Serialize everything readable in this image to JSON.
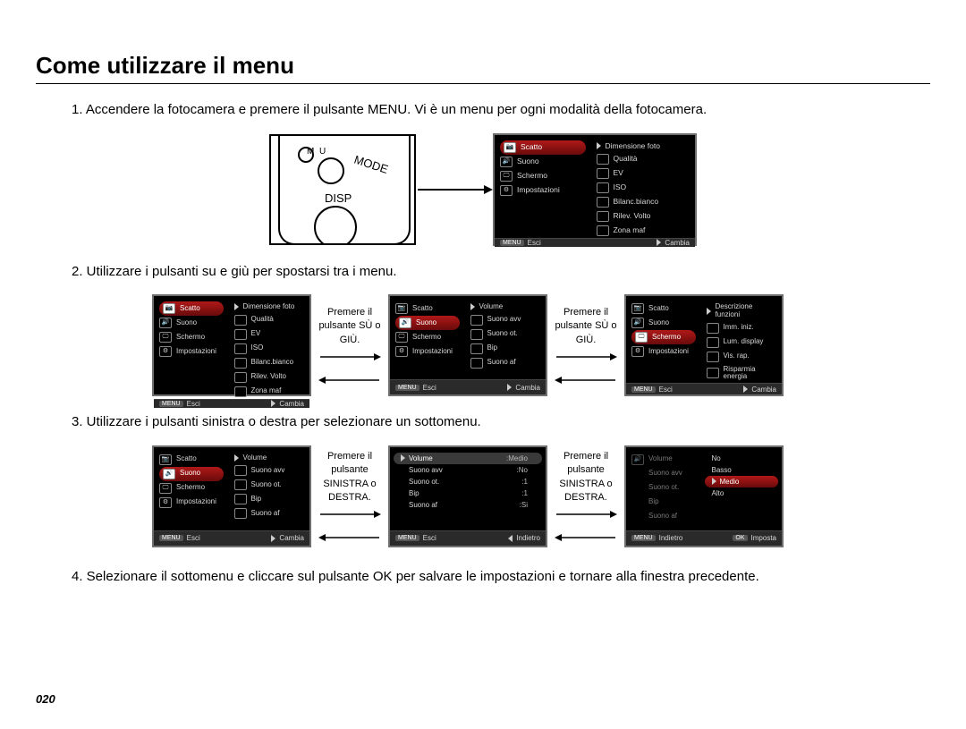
{
  "title": "Come utilizzare il menu",
  "steps": {
    "s1": "1. Accendere la fotocamera e premere il pulsante MENU. Vi è un menu per ogni modalità della fotocamera.",
    "s2": "2. Utilizzare i pulsanti su e giù per spostarsi tra i menu.",
    "s3": "3. Utilizzare i pulsanti sinistra o destra per selezionare un sottomenu.",
    "s4": "4. Selezionare il sottomenu e cliccare sul pulsante OK per salvare le impostazioni e tornare alla finestra precedente."
  },
  "hw": {
    "menu": "MENU",
    "mode": "MODE",
    "disp": "DISP"
  },
  "captions": {
    "updown": "Premere il pulsante SÙ o GIÙ.",
    "leftright": "Premere il pulsante SINISTRA o DESTRA."
  },
  "lcd_big": {
    "left": [
      "Scatto",
      "Suono",
      "Schermo",
      "Impostazioni"
    ],
    "left_sel": 0,
    "right": [
      "Dimensione foto",
      "Qualità",
      "EV",
      "ISO",
      "Bilanc.bianco",
      "Rilev. Volto",
      "Zona maf"
    ],
    "foot_l": "Esci",
    "foot_r": "Cambia",
    "foot_l_tag": "MENU"
  },
  "row2": {
    "a": {
      "left": [
        "Scatto",
        "Suono",
        "Schermo",
        "Impostazioni"
      ],
      "left_sel": 0,
      "right": [
        "Dimensione foto",
        "Qualità",
        "EV",
        "ISO",
        "Bilanc.bianco",
        "Rilev. Volto",
        "Zona maf"
      ],
      "foot_l": "Esci",
      "foot_r": "Cambia"
    },
    "b": {
      "left": [
        "Scatto",
        "Suono",
        "Schermo",
        "Impostazioni"
      ],
      "left_sel": 1,
      "right": [
        "Volume",
        "Suono avv",
        "Suono ot.",
        "Bip",
        "Suono af"
      ],
      "foot_l": "Esci",
      "foot_r": "Cambia"
    },
    "c": {
      "left": [
        "Scatto",
        "Suono",
        "Schermo",
        "Impostazioni"
      ],
      "left_sel": 2,
      "right": [
        "Descrizione funzioni",
        "Imm. iniz.",
        "Lum. display",
        "Vis. rap.",
        "Risparmia energia"
      ],
      "foot_l": "Esci",
      "foot_r": "Cambia"
    }
  },
  "row3": {
    "a": {
      "left": [
        "Scatto",
        "Suono",
        "Schermo",
        "Impostazioni"
      ],
      "left_sel": 1,
      "right": [
        "Volume",
        "Suono avv",
        "Suono ot.",
        "Bip",
        "Suono af"
      ],
      "foot_l": "Esci",
      "foot_r": "Cambia"
    },
    "b": {
      "right_kv": [
        {
          "k": "Volume",
          "v": "Medio",
          "h": true
        },
        {
          "k": "Suono avv",
          "v": "No"
        },
        {
          "k": "Suono ot.",
          "v": "1"
        },
        {
          "k": "Bip",
          "v": "1"
        },
        {
          "k": "Suono af",
          "v": "Si"
        }
      ],
      "foot_l": "Esci",
      "foot_r": "Indietro"
    },
    "c": {
      "left_k": [
        "Volume",
        "Suono avv",
        "Suono ot.",
        "Bip",
        "Suono af"
      ],
      "opts": [
        "No",
        "Basso",
        "Medio",
        "Alto"
      ],
      "opt_sel": 2,
      "foot_l": "Indietro",
      "foot_r": "Imposta"
    }
  },
  "page_number": "020",
  "foot_tag": "MENU"
}
